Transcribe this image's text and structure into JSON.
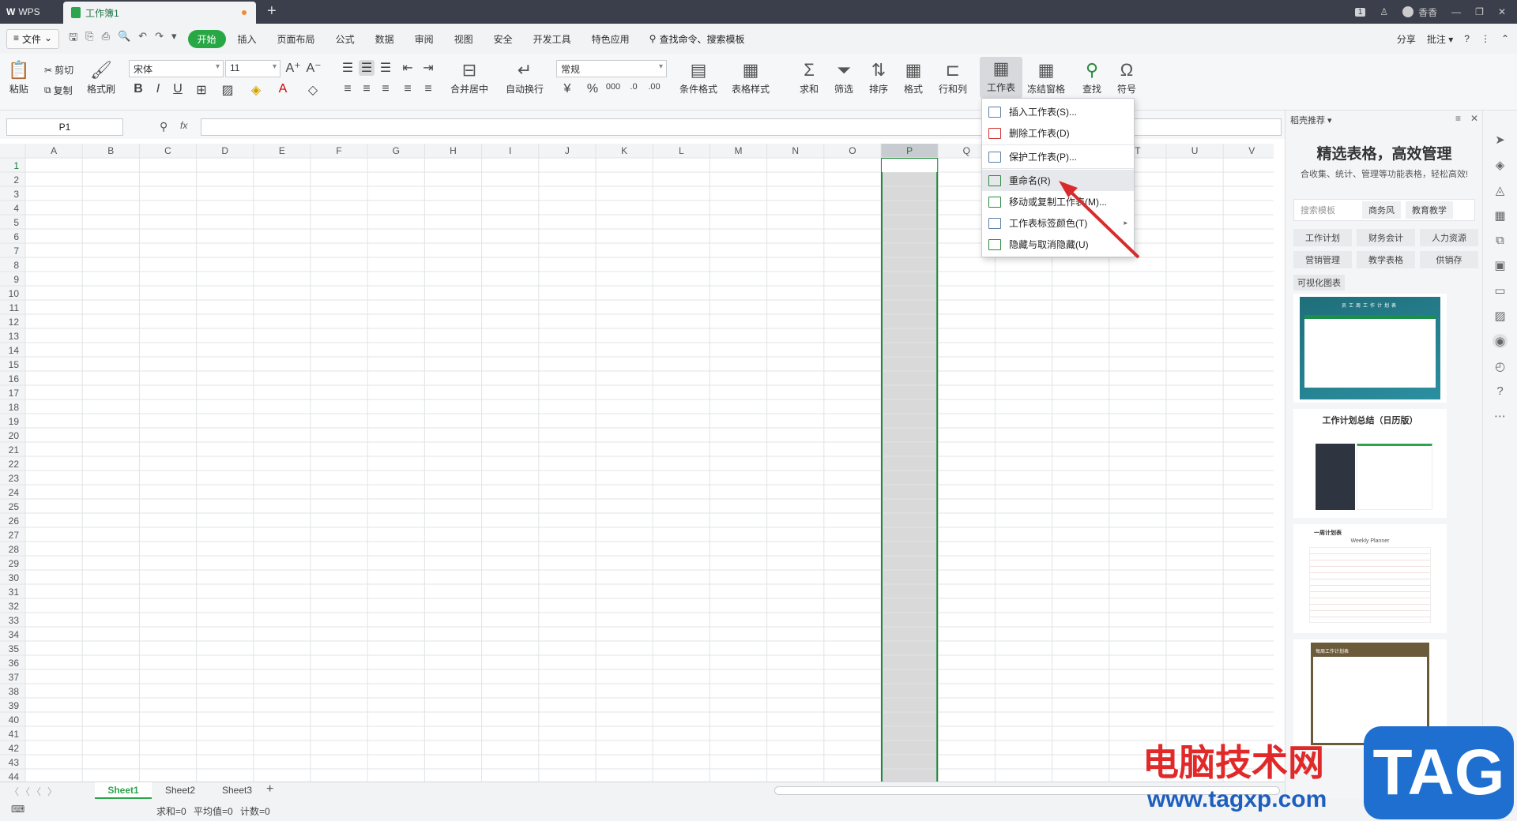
{
  "titlebar": {
    "app": "WPS",
    "doc_tab": "工作簿1",
    "user": "香香",
    "page_indicator": "1"
  },
  "menubar": {
    "file": "文件",
    "items": [
      "开始",
      "插入",
      "页面布局",
      "公式",
      "数据",
      "审阅",
      "视图",
      "安全",
      "开发工具",
      "特色应用"
    ],
    "active": "开始",
    "search": "查找命令、搜索模板",
    "share": "分享",
    "comment": "批注"
  },
  "ribbon": {
    "paste": "粘贴",
    "cut": "剪切",
    "copy": "复制",
    "format_painter": "格式刷",
    "font": "宋体",
    "size": "11",
    "merge": "合并居中",
    "wrap": "自动换行",
    "number_format": "常规",
    "cond_format": "条件格式",
    "table_style": "表格样式",
    "sum": "求和",
    "filter": "筛选",
    "sort": "排序",
    "format": "格式",
    "rowcol": "行和列",
    "worksheet": "工作表",
    "freeze": "冻结窗格",
    "find": "查找",
    "symbol": "符号"
  },
  "formula": {
    "cell_ref": "P1",
    "fx": "fx"
  },
  "grid": {
    "columns": [
      "A",
      "B",
      "C",
      "D",
      "E",
      "F",
      "G",
      "H",
      "I",
      "J",
      "K",
      "L",
      "M",
      "N",
      "O",
      "P",
      "Q",
      "R",
      "S",
      "T",
      "U",
      "V"
    ],
    "rows": 44,
    "selected_column": "P"
  },
  "context_menu": {
    "items": [
      {
        "label": "插入工作表(S)...",
        "color": "blue"
      },
      {
        "label": "删除工作表(D)",
        "color": "red"
      },
      {
        "label": "保护工作表(P)...",
        "color": "blue"
      },
      {
        "label": "重命名(R)",
        "color": "green"
      },
      {
        "label": "移动或复制工作表(M)...",
        "color": "green"
      },
      {
        "label": "工作表标签颜色(T)",
        "color": "blue",
        "submenu": true
      },
      {
        "label": "隐藏与取消隐藏(U)",
        "color": "green"
      }
    ]
  },
  "sheets": {
    "tabs": [
      "Sheet1",
      "Sheet2",
      "Sheet3"
    ],
    "active": "Sheet1"
  },
  "status": {
    "sum": "求和=0",
    "avg": "平均值=0",
    "count": "计数=0"
  },
  "rpanel": {
    "header": "稻壳推荐",
    "title": "精选表格，高效管理",
    "subtitle": "合收集、统计、管理等功能表格，轻松高效!",
    "search_placeholder": "搜索模板",
    "tags_top": [
      "商务风",
      "教育教学"
    ],
    "tags": [
      "工作计划",
      "财务会计",
      "人力资源",
      "营销管理",
      "教学表格",
      "供销存"
    ],
    "section": "可视化图表",
    "cards": [
      "员工周工作计划表",
      "工作计划总结（日历版）",
      "Weekly Planner",
      "一周计划表",
      "每周工作计划表"
    ]
  },
  "watermark": {
    "text": "电脑技术网",
    "url": "www.tagxp.com",
    "logo": "TAG"
  }
}
